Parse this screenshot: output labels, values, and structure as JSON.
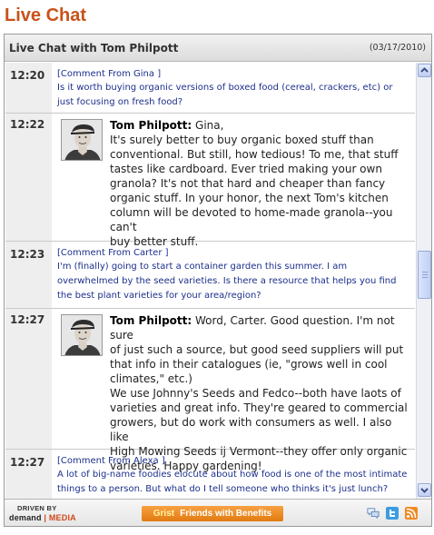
{
  "page_title": "Live Chat",
  "widget": {
    "title": "Live Chat with Tom Philpott",
    "date": "(03/17/2010)"
  },
  "messages": [
    {
      "time": "12:20",
      "type": "guest",
      "from": "[Comment From Gina ]",
      "text": "Is it worth buying organic versions of boxed food (cereal, crackers, etc) or just focusing on fresh food?"
    },
    {
      "time": "12:22",
      "type": "host",
      "name": "Tom Philpott:",
      "lines": [
        "Gina,",
        "It's surely better to buy organic boxed stuff than",
        "conventional. But still, how tedious! To me, that stuff",
        "tastes like cardboard. Ever tried making your own",
        "granola? It's not that hard and cheaper than fancy",
        "organic stuff. In your honor, the next Tom's kitchen",
        "column will be devoted to home-made granola--you can't",
        "buy better stuff."
      ]
    },
    {
      "time": "12:23",
      "type": "guest",
      "from": "[Comment From Carter ]",
      "text": "I'm (finally) going to start a container garden this summer. I am overwhelmed by the seed varieties. Is there a resource that helps you find the best plant varieties for your area/region?"
    },
    {
      "time": "12:27",
      "type": "host",
      "name": "Tom Philpott:",
      "lines": [
        "Word, Carter. Good question. I'm not sure",
        "of just such a source, but good seed suppliers will put",
        "that info in their catalogues (ie, \"grows well in cool",
        "climates,\" etc.)",
        "We use Johnny's Seeds and Fedco--both have laots of",
        "varieties and great info. They're geared to commercial",
        "growers, but do work with consumers as well. I also like",
        "High Mowing Seeds ij Vermont--they offer only organic",
        "varieties. Happy gardening!"
      ]
    },
    {
      "time": "12:27",
      "type": "guest",
      "from": "[Comment From Alexa ]",
      "text": "A lot of big-name foodies elocute about how food is one of the most intimate things to a person. But what do I tell someone who thinks it's just lunch?"
    }
  ],
  "footer": {
    "driven_by": "DRIVEN BY",
    "logo_demand": "demand",
    "logo_sep": "|",
    "logo_media": "MEDIA",
    "promo_brand": "Grist",
    "promo_text": "Friends with Benefits"
  },
  "icons": {
    "chat": "chat-bubbles-icon",
    "twitter": "twitter-icon",
    "rss": "rss-icon"
  },
  "colors": {
    "title": "#c8521a",
    "link": "#1c2f8c",
    "promo": "#f39226"
  }
}
